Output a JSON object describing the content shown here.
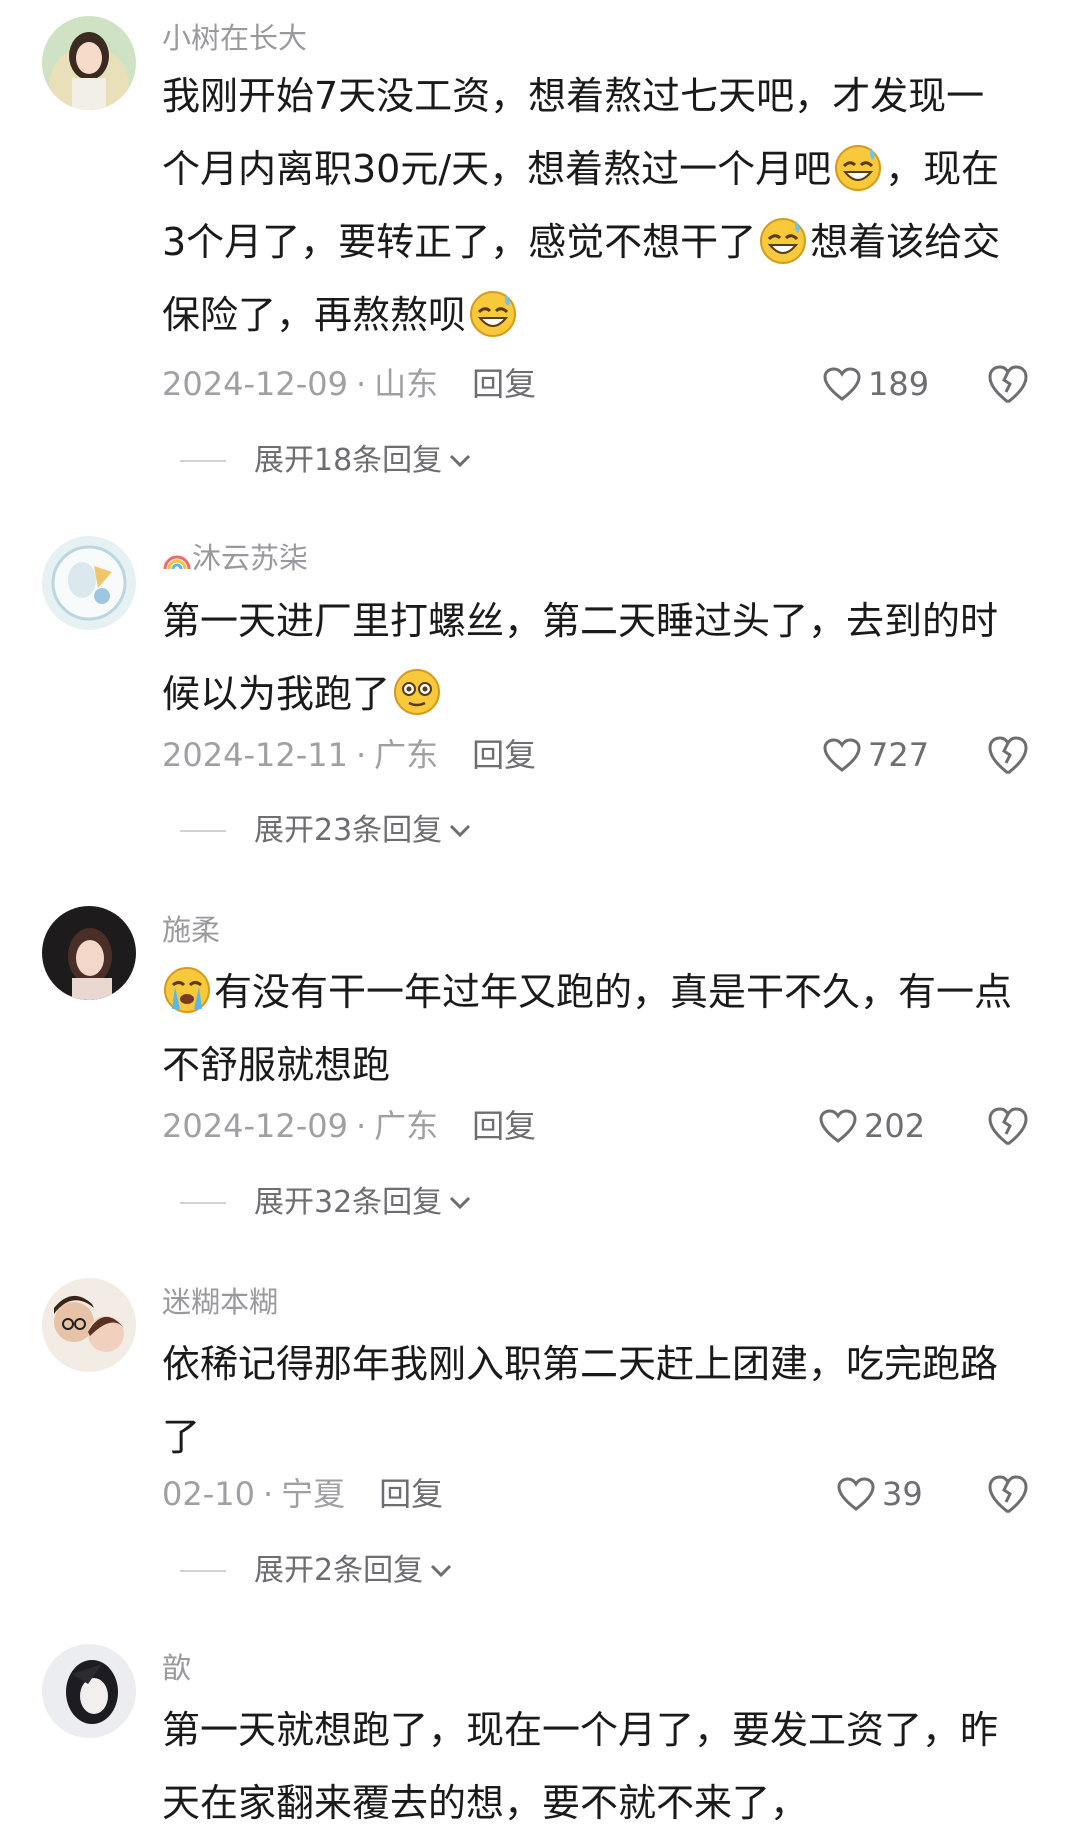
{
  "comments": [
    {
      "username": "小树在长大",
      "lines": [
        "我刚开始7天没工资，想着熬过七天吧，才发现一",
        "个月内离职30元/天，想着熬过一个月吧",
        "，现在",
        "3个月了，要转正了，感觉不想干了",
        "想着该给交",
        "保险了，再熬熬呗"
      ],
      "date": "2024-12-09",
      "location": "山东",
      "reply_label": "回复",
      "likes": "189",
      "expand_label": "展开18条回复"
    },
    {
      "username_prefix_icon": "rainbow-icon",
      "username": "沐云苏柒",
      "lines": [
        "第一天进厂里打螺丝，第二天睡过头了，去到的时",
        "候以为我跑了"
      ],
      "date": "2024-12-11",
      "location": "广东",
      "reply_label": "回复",
      "likes": "727",
      "expand_label": "展开23条回复"
    },
    {
      "username": "施柔",
      "lines": [
        "有没有干一年过年又跑的，真是干不久，有一点",
        "不舒服就想跑"
      ],
      "date": "2024-12-09",
      "location": "广东",
      "reply_label": "回复",
      "likes": "202",
      "expand_label": "展开32条回复"
    },
    {
      "username": "迷糊本糊",
      "lines": [
        "依稀记得那年我刚入职第二天赶上团建，吃完跑路",
        "了"
      ],
      "date": "02-10",
      "location": "宁夏",
      "reply_label": "回复",
      "likes": "39",
      "expand_label": "展开2条回复"
    },
    {
      "username": "歆",
      "lines": [
        "第一天就想跑了，现在一个月了，要发工资了，昨",
        "天在家翻来覆去的想，要不就不来了，"
      ]
    }
  ],
  "colors": {
    "background": "#ffffff",
    "text": "#1a1a1a",
    "meta": "#a0a0a4",
    "accent_gray": "#6d6d72"
  }
}
